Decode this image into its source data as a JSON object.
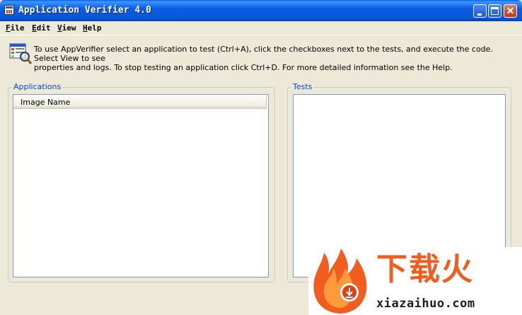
{
  "window": {
    "title": "Application Verifier 4.0",
    "icon": "appverifier-icon"
  },
  "titlebar_buttons": [
    "minimize-icon",
    "maximize-icon",
    "close-icon"
  ],
  "menu": {
    "file": {
      "hotkey": "F",
      "rest": "ile"
    },
    "edit": {
      "hotkey": "E",
      "rest": "dit"
    },
    "view": {
      "hotkey": "V",
      "rest": "iew"
    },
    "help": {
      "hotkey": "H",
      "rest": "elp"
    }
  },
  "info": {
    "line1": "To use AppVerifier select an application to test (Ctrl+A), click the checkboxes next to the tests, and execute the code. Select View to see",
    "line2": "properties and logs. To stop testing an application click Ctrl+D. For more detailed information see the Help."
  },
  "applications": {
    "label": "Applications",
    "column_header": "Image Name",
    "rows": []
  },
  "tests": {
    "label": "Tests",
    "rows": []
  },
  "watermark": {
    "brand": "下载火",
    "url": "xiazaihuo.com"
  },
  "colors": {
    "titlebar": "#0b5ee0",
    "group_label": "#0046d5",
    "background": "#ece9d8",
    "brand": "#f25c1e"
  }
}
